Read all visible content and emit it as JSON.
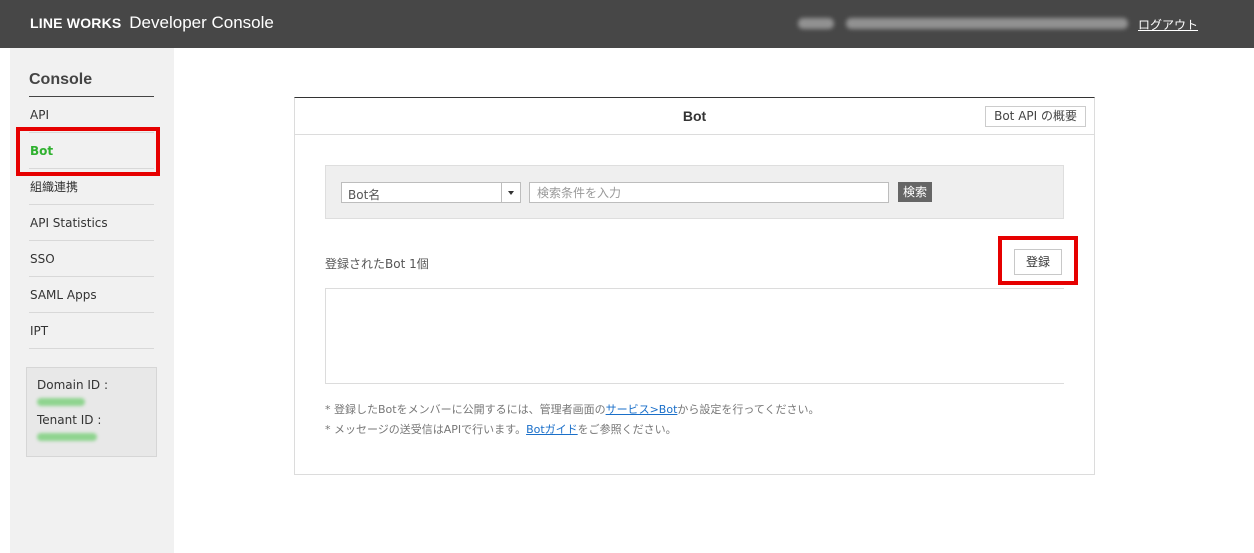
{
  "header": {
    "brand_mark": "LINE WORKS",
    "brand_product": "Developer Console",
    "logout_label": "ログアウト"
  },
  "sidebar": {
    "title": "Console",
    "items": [
      {
        "label": "API"
      },
      {
        "label": "Bot",
        "active": true
      },
      {
        "label": "組織連携"
      },
      {
        "label": "API Statistics"
      },
      {
        "label": "SSO"
      },
      {
        "label": "SAML Apps"
      },
      {
        "label": "IPT"
      }
    ],
    "domain_id_label": "Domain ID :",
    "tenant_id_label": "Tenant ID :"
  },
  "main": {
    "title": "Bot",
    "overview_button": "Bot API の概要",
    "search": {
      "select_value": "Bot名",
      "input_placeholder": "検索条件を入力",
      "button_label": "検索"
    },
    "bot_count_text": "登録されたBot 1個",
    "register_button": "登録",
    "notes": [
      {
        "prefix": "* 登録したBotをメンバーに公開するには、管理者画面の",
        "link": "サービス>Bot",
        "suffix": "から設定を行ってください。"
      },
      {
        "prefix": "* メッセージの送受信はAPIで行います。",
        "link": "Botガイド",
        "suffix": "をご参照ください。"
      }
    ]
  },
  "colors": {
    "header_bg": "#474747",
    "active_item": "#2fb12f",
    "highlight_box": "#e60000",
    "link": "#1a6fc9"
  }
}
